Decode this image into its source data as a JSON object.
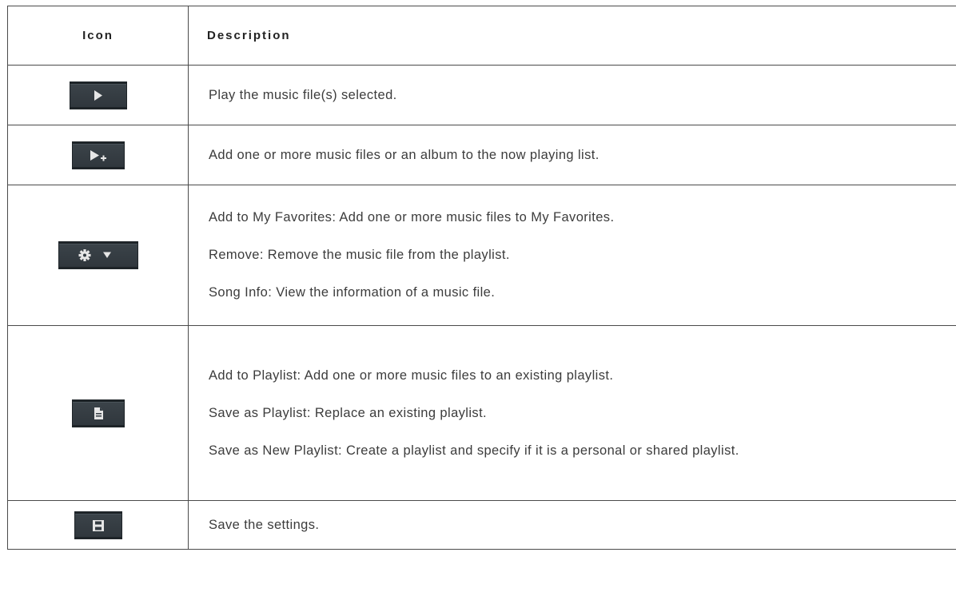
{
  "table": {
    "headers": {
      "icon": "Icon",
      "description": "Description"
    },
    "rows": [
      {
        "icon": "play-icon",
        "lines": [
          "Play the music file(s) selected."
        ]
      },
      {
        "icon": "add-to-now-playing-icon",
        "lines": [
          "Add one or more music files or an album to the now playing list."
        ]
      },
      {
        "icon": "gear-dropdown-icon",
        "lines": [
          "Add to My Favorites: Add one or more music files to My Favorites.",
          "Remove: Remove the music file from the playlist.",
          "Song Info: View the information of a music file."
        ]
      },
      {
        "icon": "playlist-document-icon",
        "lines": [
          "Add to Playlist: Add one or more music files to an existing playlist.",
          "Save as Playlist: Replace an existing playlist.",
          "Save as New Playlist: Create a playlist and specify if it is a personal or shared playlist."
        ]
      },
      {
        "icon": "save-icon",
        "lines": [
          "Save the settings."
        ]
      }
    ]
  },
  "colors": {
    "button_bg": "#343c42",
    "button_border": "#1e2428",
    "glyph": "#e6e6e6",
    "border": "#4a4a4a"
  }
}
